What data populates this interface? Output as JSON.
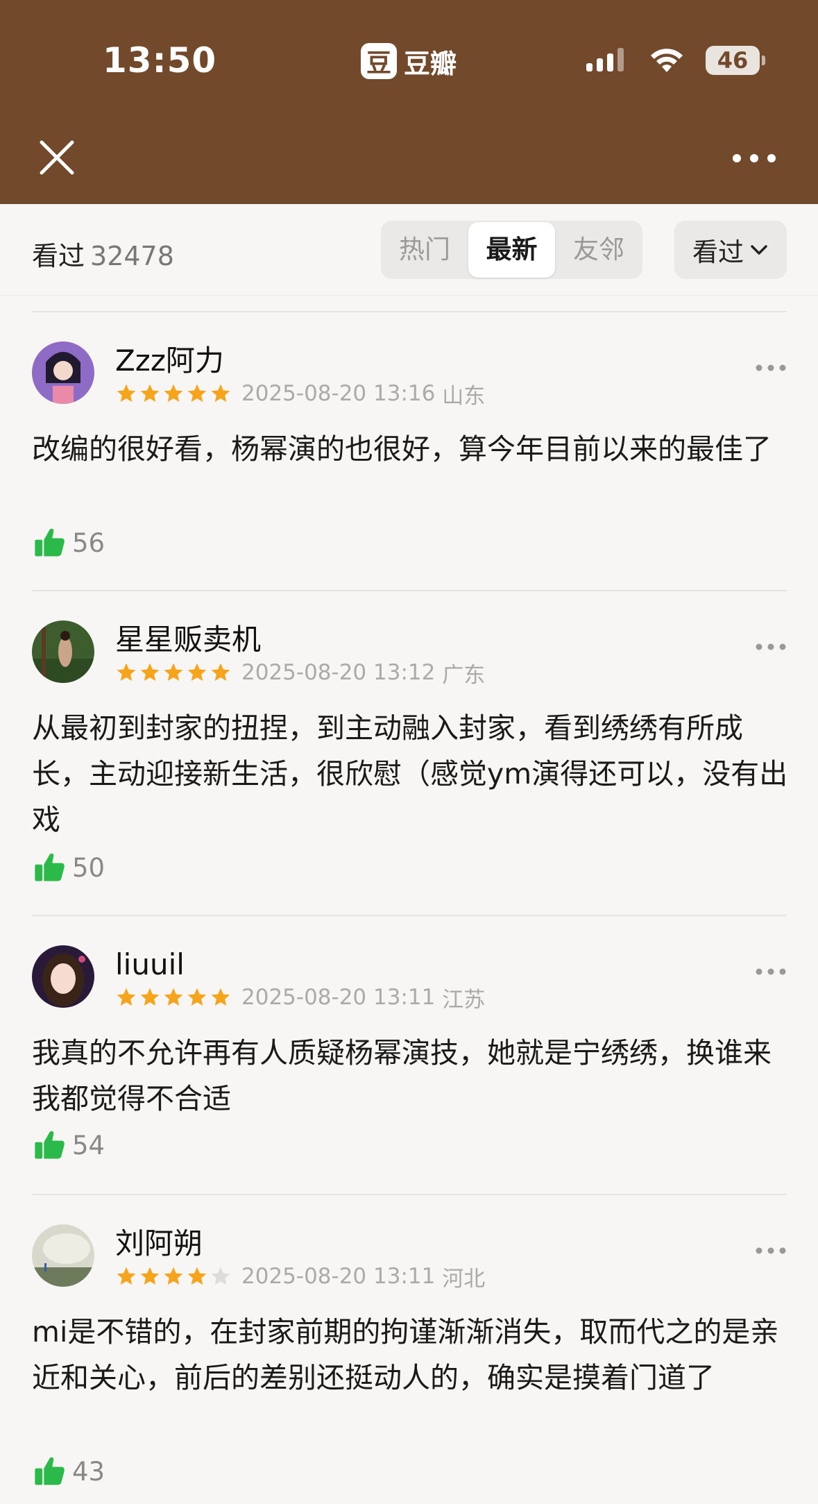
{
  "status_bar": {
    "time": "13:50",
    "battery": "46"
  },
  "app": {
    "logo_char": "豆",
    "name": "豆瓣"
  },
  "colors": {
    "header_bg": "#724a2b",
    "star": "#f7a41d",
    "like": "#2bb94a"
  },
  "tabs": {
    "watched_label": "看过",
    "watched_count": "32478",
    "segments": [
      "热门",
      "最新",
      "友邻"
    ],
    "active_segment": "最新",
    "filter_label": "看过"
  },
  "reviews": [
    {
      "username": "Zzz阿力",
      "rating": 5,
      "datetime": "2025-08-20 13:16",
      "location": "山东",
      "content": "改编的很好看，杨幂演的也很好，算今年目前以来的最佳了",
      "likes": "56"
    },
    {
      "username": "星星贩卖机",
      "rating": 5,
      "datetime": "2025-08-20 13:12",
      "location": "广东",
      "content": "从最初到封家的扭捏，到主动融入封家，看到绣绣有所成长，主动迎接新生活，很欣慰（感觉ym演得还可以，没有出戏",
      "likes": "50"
    },
    {
      "username": "liuuil",
      "rating": 5,
      "datetime": "2025-08-20 13:11",
      "location": "江苏",
      "content": "我真的不允许再有人质疑杨幂演技，她就是宁绣绣，换谁来我都觉得不合适",
      "likes": "54"
    },
    {
      "username": "刘阿朔",
      "rating": 4,
      "datetime": "2025-08-20 13:11",
      "location": "河北",
      "content": "mi是不错的，在封家前期的拘谨渐渐消失，取而代之的是亲近和关心，前后的差别还挺动人的，确实是摸着门道了",
      "likes": "43"
    }
  ]
}
